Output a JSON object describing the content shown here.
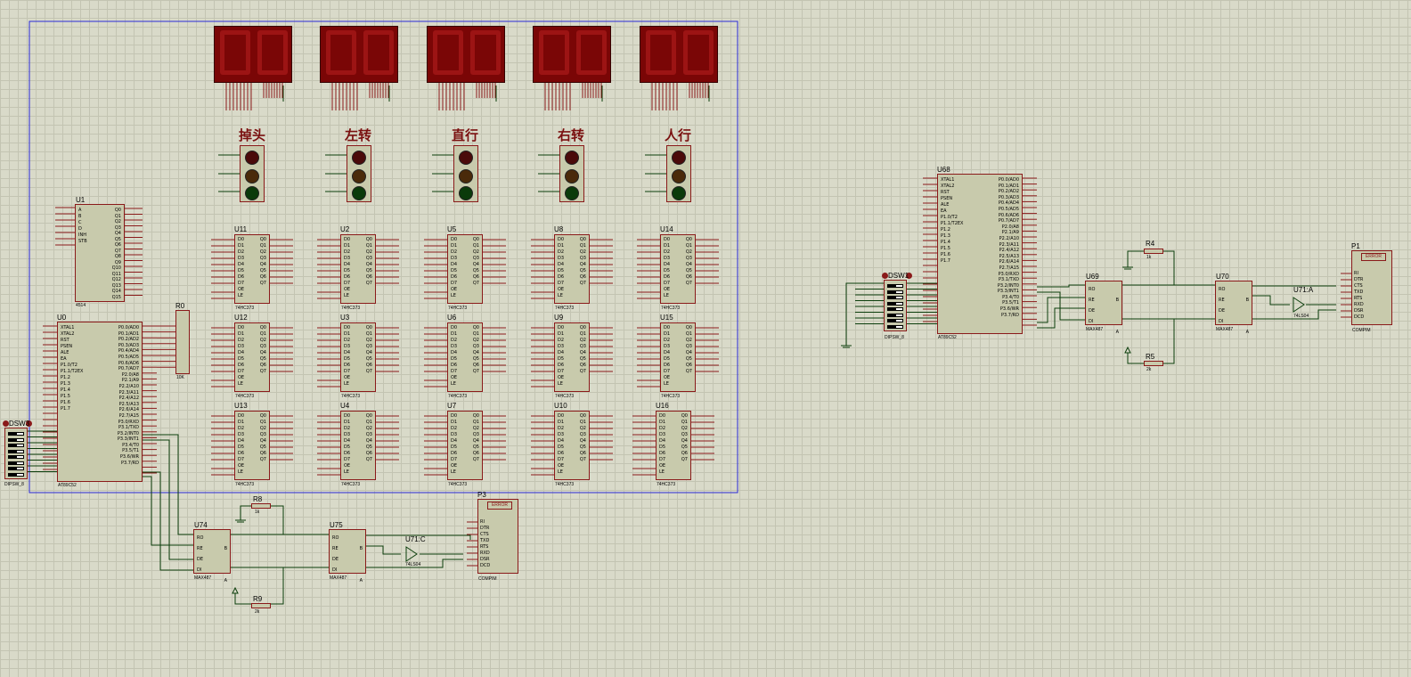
{
  "schematic": {
    "signal_labels": [
      "掉头",
      "左转",
      "直行",
      "右转",
      "人行"
    ],
    "latches": [
      {
        "ref": "U11",
        "type": "74HC373"
      },
      {
        "ref": "U2",
        "type": "74HC373"
      },
      {
        "ref": "U5",
        "type": "74HC373"
      },
      {
        "ref": "U8",
        "type": "74HC373"
      },
      {
        "ref": "U14",
        "type": "74HC373"
      },
      {
        "ref": "U12",
        "type": "74HC373"
      },
      {
        "ref": "U3",
        "type": "74HC373"
      },
      {
        "ref": "U6",
        "type": "74HC373"
      },
      {
        "ref": "U9",
        "type": "74HC373"
      },
      {
        "ref": "U15",
        "type": "74HC373"
      },
      {
        "ref": "U13",
        "type": "74HC373"
      },
      {
        "ref": "U4",
        "type": "74HC373"
      },
      {
        "ref": "U7",
        "type": "74HC373"
      },
      {
        "ref": "U10",
        "type": "74HC373"
      },
      {
        "ref": "U16",
        "type": "74HC373"
      }
    ],
    "latch_in_pins": [
      "D0",
      "D1",
      "D2",
      "D3",
      "D4",
      "D5",
      "D6",
      "D7",
      "",
      "OE",
      "LE"
    ],
    "latch_out_pins": [
      "Q0",
      "Q1",
      "Q2",
      "Q3",
      "Q4",
      "Q5",
      "Q6",
      "Q7"
    ],
    "decoder": {
      "ref": "U1",
      "type": "4514",
      "in_pins": [
        "A",
        "B",
        "C",
        "D",
        "",
        "INH",
        "STB"
      ],
      "out_pins": [
        "Q0",
        "Q1",
        "Q2",
        "Q3",
        "Q4",
        "Q5",
        "Q6",
        "Q7",
        "Q8",
        "Q9",
        "Q10",
        "Q11",
        "Q12",
        "Q13",
        "Q14",
        "Q15"
      ]
    },
    "mcu_left": {
      "ref": "U0",
      "type": "AT89C52"
    },
    "mcu_right": {
      "ref": "U68",
      "type": "AT89C52"
    },
    "mcu_pins_left": [
      "XTAL1",
      "",
      "XTAL2",
      "",
      "",
      "RST",
      "",
      "",
      "",
      "",
      "",
      "PSEN",
      "ALE",
      "EA",
      "",
      "",
      "P1.0/T2",
      "P1.1/T2EX",
      "P1.2",
      "P1.3",
      "P1.4",
      "P1.5",
      "P1.6",
      "P1.7"
    ],
    "mcu_pins_right": [
      "P0.0/AD0",
      "P0.1/AD1",
      "P0.2/AD2",
      "P0.3/AD3",
      "P0.4/AD4",
      "P0.5/AD5",
      "P0.6/AD6",
      "P0.7/AD7",
      "",
      "P2.0/A8",
      "P2.1/A9",
      "P2.2/A10",
      "P2.3/A11",
      "P2.4/A12",
      "P2.5/A13",
      "P2.6/A14",
      "P2.7/A15",
      "",
      "P3.0/RXD",
      "P3.1/TXD",
      "P3.2/INT0",
      "P3.3/INT1",
      "P3.4/T0",
      "P3.5/T1",
      "P3.6/WR",
      "P3.7/RD"
    ],
    "resnet": {
      "ref": "R0",
      "value": "10K"
    },
    "dipsw_left": {
      "ref": "DSW3",
      "type": "DIPSW_8"
    },
    "dipsw_right": {
      "ref": "DSW1",
      "type": "DIPSW_8"
    },
    "transceivers": [
      {
        "ref": "U74",
        "type": "MAX487"
      },
      {
        "ref": "U75",
        "type": "MAX487"
      },
      {
        "ref": "U69",
        "type": "MAX487"
      },
      {
        "ref": "U70",
        "type": "MAX487"
      }
    ],
    "max487_left_pins": [
      "RO",
      "RE",
      "DE",
      "DI"
    ],
    "max487_right_pins": [
      "B",
      "A"
    ],
    "inverters": [
      {
        "ref": "U71:C",
        "type": "74LS04"
      },
      {
        "ref": "U71:A",
        "type": "74LS04"
      }
    ],
    "resistors": [
      {
        "ref": "R8",
        "value": "1k"
      },
      {
        "ref": "R9",
        "value": "2k"
      },
      {
        "ref": "R4",
        "value": "1k"
      },
      {
        "ref": "R5",
        "value": "2k"
      }
    ],
    "compims": [
      {
        "ref": "P3",
        "type": "COMPIM"
      },
      {
        "ref": "P1",
        "type": "COMPIM"
      }
    ],
    "compim_pins": [
      "DCD",
      "DSR",
      "RXD",
      "RTS",
      "TXD",
      "CTS",
      "DTR",
      "RI"
    ],
    "error_text": "ERROR"
  }
}
